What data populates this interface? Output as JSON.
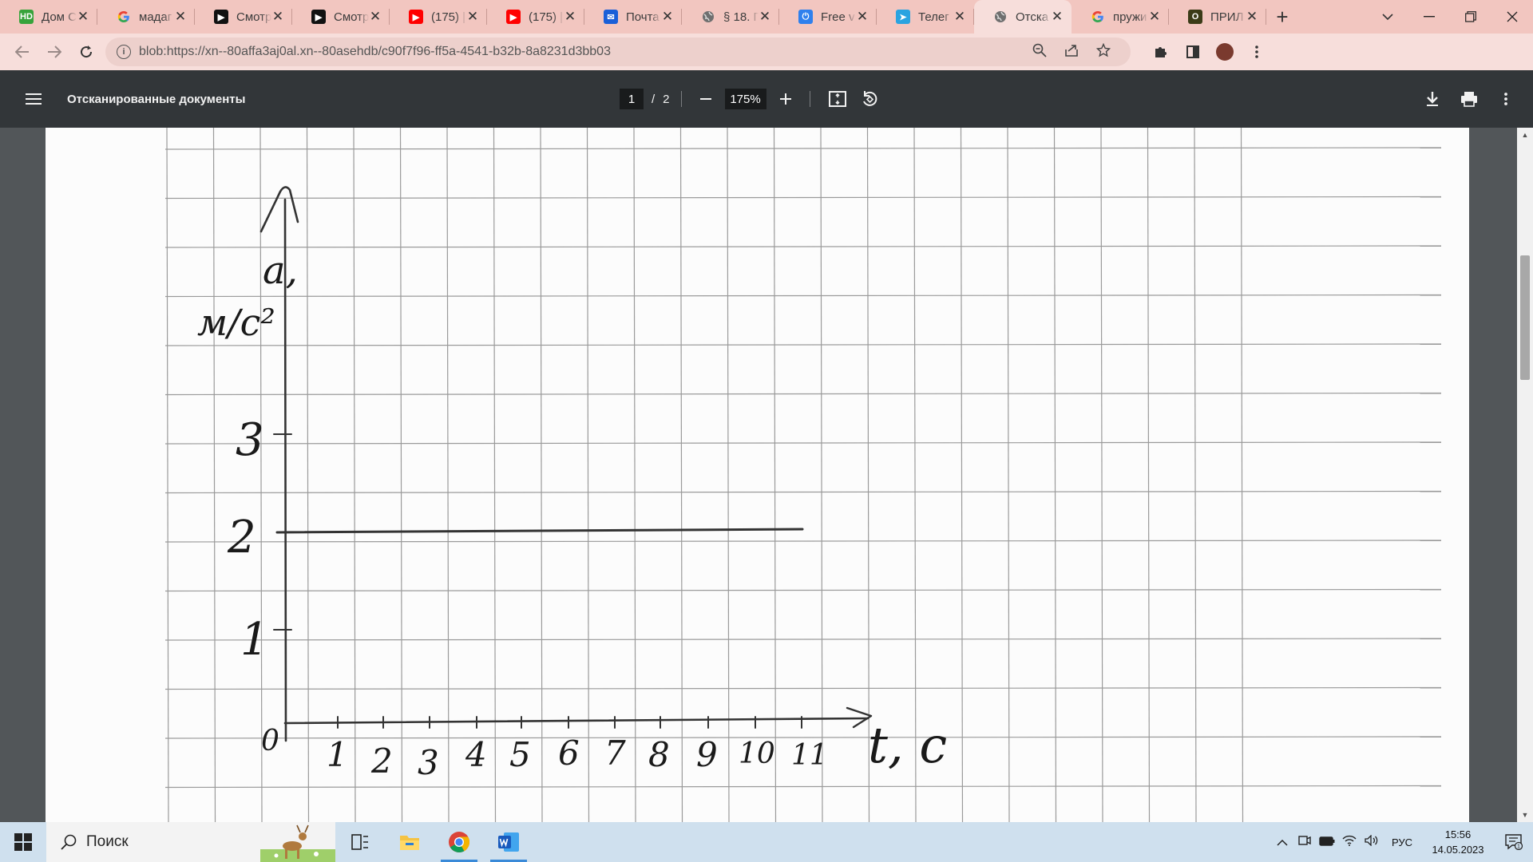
{
  "browser": {
    "tabs": [
      {
        "icon": "hd-icon",
        "fav_text": "HD",
        "fav_color": "#37a33b",
        "title": "Дом С",
        "active": false
      },
      {
        "icon": "google-icon",
        "fav_text": "G",
        "fav_color": "",
        "title": "мадаг",
        "active": false
      },
      {
        "icon": "video-play-icon",
        "fav_text": "▶",
        "fav_color": "#111111",
        "title": "Смотр",
        "active": false
      },
      {
        "icon": "video-play-icon",
        "fav_text": "▶",
        "fav_color": "#111111",
        "title": "Смотр",
        "active": false
      },
      {
        "icon": "youtube-icon",
        "fav_text": "▶",
        "fav_color": "#ff0000",
        "title": "(175) |",
        "active": false
      },
      {
        "icon": "youtube-icon",
        "fav_text": "▶",
        "fav_color": "#ff0000",
        "title": "(175) |",
        "active": false
      },
      {
        "icon": "mail-icon",
        "fav_text": "✉",
        "fav_color": "#1a5fd8",
        "title": "Почта",
        "active": false
      },
      {
        "icon": "globe-icon",
        "fav_text": "◍",
        "fav_color": "#777777",
        "title": "§ 18. Г",
        "active": false
      },
      {
        "icon": "power-icon",
        "fav_text": "⏻",
        "fav_color": "#2f80ed",
        "title": "Free v",
        "active": false
      },
      {
        "icon": "telegram-icon",
        "fav_text": "➤",
        "fav_color": "#2aa3e0",
        "title": "Телег",
        "active": false
      },
      {
        "icon": "globe-icon",
        "fav_text": "◍",
        "fav_color": "#777777",
        "title": "Отска",
        "active": true
      },
      {
        "icon": "google-icon",
        "fav_text": "G",
        "fav_color": "",
        "title": "пружи",
        "active": false
      },
      {
        "icon": "doc-o-icon",
        "fav_text": "O",
        "fav_color": "#3b3b17",
        "title": "ПРИЛ",
        "active": false
      }
    ],
    "new_tab_label": "+",
    "url": "blob:https://xn--80affa3aj0al.xn--80asehdb/c90f7f96-ff5a-4541-b32b-8a8231d3bb03"
  },
  "pdf": {
    "title": "Отсканированные документы",
    "current_page": "1",
    "page_sep": "/",
    "total_pages": "2",
    "zoom": "175%"
  },
  "taskbar": {
    "search_placeholder": "Поиск",
    "lang": "РУС",
    "time": "15:56",
    "date": "14.05.2023",
    "notif_count": "1"
  }
}
